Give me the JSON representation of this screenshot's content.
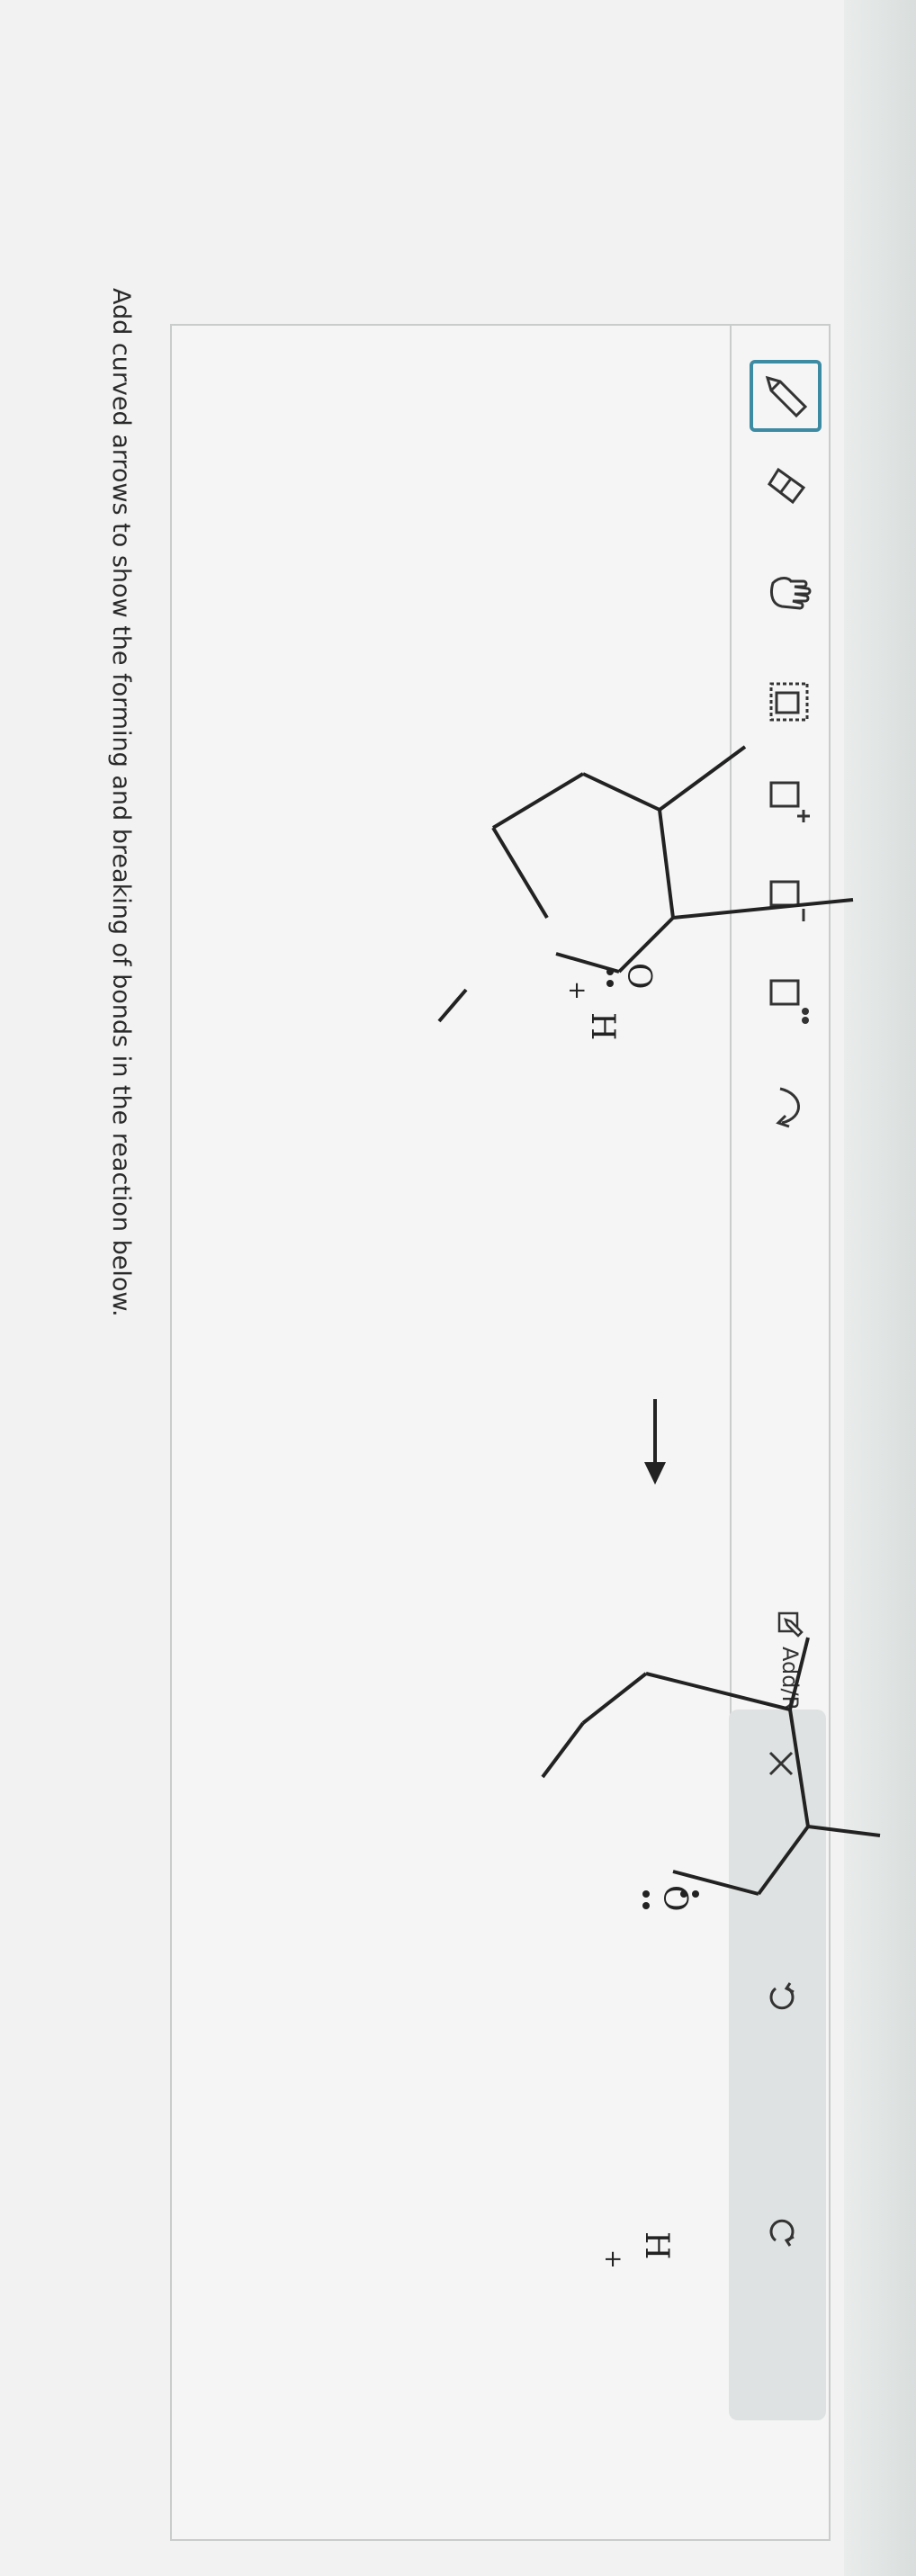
{
  "prompt": "Add curved arrows to show the forming and breaking of bonds in the reaction below.",
  "toolbar": {
    "tools": [
      "pencil-tool",
      "eraser-tool",
      "hand-tool",
      "select-box-tool",
      "plus-charge-tool",
      "minus-charge-tool",
      "lone-pair-tool",
      "curved-arrow-tool"
    ],
    "add_remove_label": "Add/Remove step"
  },
  "side_buttons": [
    "close-icon",
    "undo-icon",
    "redo-icon"
  ],
  "reactant": {
    "oxygen": "O",
    "hydrogen": "H",
    "charge": "+"
  },
  "product": {
    "oxygen": "O",
    "proton": "H",
    "proton_charge": "+"
  },
  "colors": {
    "accent": "#3d8aa3",
    "text": "#2a2a2a",
    "bond": "#222222"
  }
}
